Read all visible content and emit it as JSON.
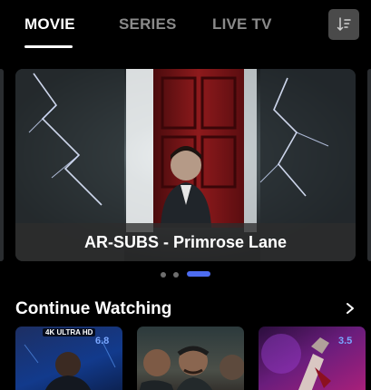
{
  "tabs": [
    {
      "label": "MOVIE",
      "active": true
    },
    {
      "label": "SERIES",
      "active": false
    },
    {
      "label": "LIVE TV",
      "active": false
    }
  ],
  "sort_icon": "sort-descending-icon",
  "hero": {
    "caption": "AR-SUBS - Primrose Lane",
    "page_count": 3,
    "active_page": 3
  },
  "continue_watching": {
    "title": "Continue Watching",
    "arrow_icon": "chevron-right-icon",
    "items": [
      {
        "rating": "6.8",
        "badge": "4K ULTRA HD"
      },
      {
        "rating": ""
      },
      {
        "rating": "3.5"
      }
    ]
  },
  "colors": {
    "accent": "#4d6cf0",
    "rating": "#7aa7ff",
    "inactive_tab": "#8a8a8a"
  }
}
